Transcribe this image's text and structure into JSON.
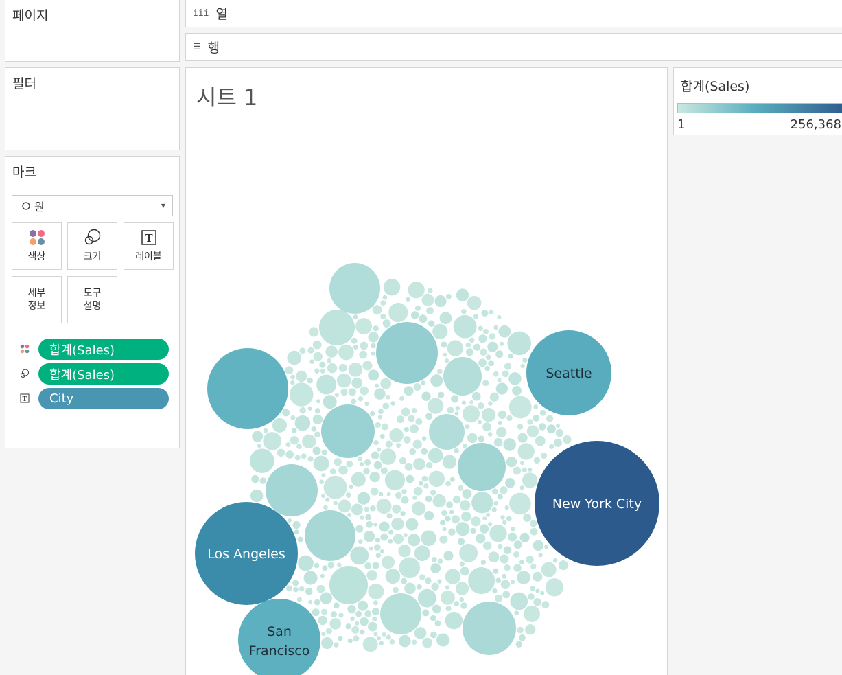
{
  "cards": {
    "pages_title": "페이지",
    "filters_title": "필터",
    "marks_title": "마크"
  },
  "shelves": {
    "columns_label": "열",
    "rows_label": "행"
  },
  "marks": {
    "type_label": "원",
    "buttons": {
      "color": "색상",
      "size": "크기",
      "label": "레이블",
      "detail_line1": "세부",
      "detail_line2": "정보",
      "tooltip_line1": "도구",
      "tooltip_line2": "설명"
    },
    "pills": [
      {
        "role": "color",
        "text": "합계(Sales)",
        "kind": "measure",
        "icon": "color-icon"
      },
      {
        "role": "size",
        "text": "합계(Sales)",
        "kind": "measure",
        "icon": "size-icon"
      },
      {
        "role": "label",
        "text": "City",
        "kind": "dimension",
        "icon": "label-icon"
      }
    ]
  },
  "sheet": {
    "title": "시트 1"
  },
  "legend": {
    "title": "합계(Sales)",
    "min": "1",
    "max": "256,368",
    "color_low": "#c9e8e0",
    "color_high": "#2c5a8c"
  },
  "colors": {
    "measure_pill": "#00b180",
    "dimension_pill": "#4996b2"
  },
  "chart_data": {
    "type": "packed-bubble",
    "measure": "합계(Sales)",
    "color_range": [
      1,
      256368
    ],
    "labeled_bubbles": [
      {
        "city": "New York City",
        "sales": 256368
      },
      {
        "city": "Los Angeles",
        "sales": 175851
      },
      {
        "city": "Seattle",
        "sales": 119541
      },
      {
        "city": "San Francisco",
        "sales": 112669
      }
    ],
    "unlabeled_large_bubbles": [
      108000,
      63000,
      56000,
      47000,
      44000,
      39000,
      36000,
      30000,
      26000,
      25000,
      20000,
      15000,
      12000
    ],
    "unlabeled_small_bubble_count": 500
  }
}
